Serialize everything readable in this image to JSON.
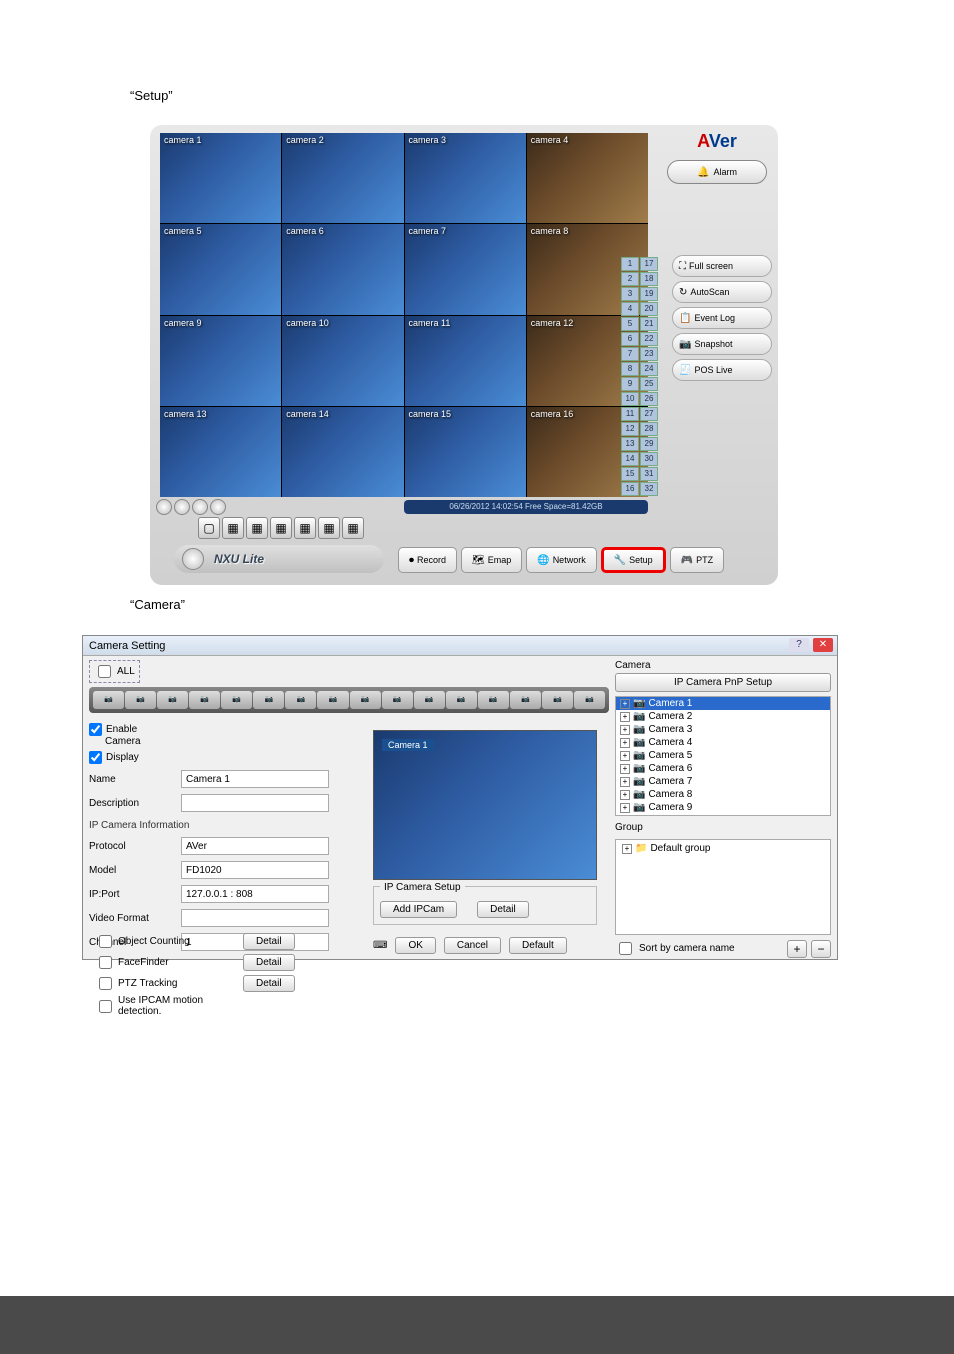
{
  "instructions": {
    "line1": "“Setup”",
    "line2": "“Camera”"
  },
  "app": {
    "logo": "AVer",
    "alarm": "Alarm",
    "brand": "NXU Lite",
    "status": "06/26/2012 14:02:54  Free Space=81.42GB",
    "side_buttons": [
      "Full screen",
      "AutoScan",
      "Event Log",
      "Snapshot",
      "POS Live"
    ],
    "bottom_buttons": [
      "Record",
      "Emap",
      "Network",
      "Setup",
      "PTZ"
    ],
    "cameras": [
      "camera 1",
      "camera 2",
      "camera 3",
      "camera 4",
      "camera 5",
      "camera 6",
      "camera 7",
      "camera 8",
      "camera 9",
      "camera 10",
      "camera 11",
      "camera 12",
      "camera 13",
      "camera 14",
      "camera 15",
      "camera 16"
    ],
    "channel_numbers": [
      "1",
      "17",
      "2",
      "18",
      "3",
      "19",
      "4",
      "20",
      "5",
      "21",
      "6",
      "22",
      "7",
      "23",
      "8",
      "24",
      "9",
      "25",
      "10",
      "26",
      "11",
      "27",
      "12",
      "28",
      "13",
      "29",
      "14",
      "30",
      "15",
      "31",
      "16",
      "32"
    ]
  },
  "dialog": {
    "title": "Camera Setting",
    "all": "ALL",
    "enable": "Enable",
    "camera_lbl": "Camera",
    "display": "Display",
    "name_lbl": "Name",
    "name_val": "Camera 1",
    "desc_lbl": "Description",
    "desc_val": "",
    "ip_info": "IP Camera Information",
    "protocol_lbl": "Protocol",
    "protocol_val": "AVer",
    "model_lbl": "Model",
    "model_val": "FD1020",
    "ipport_lbl": "IP:Port",
    "ipport_val": "127.0.0.1 : 808",
    "vfmt_lbl": "Video Format",
    "vfmt_val": "",
    "channel_lbl": "Channel",
    "channel_val": "1",
    "obj_counting": "Object Counting",
    "facefinder": "FaceFinder",
    "ptz_tracking": "PTZ Tracking",
    "use_ipcam": "Use IPCAM motion detection.",
    "detail": "Detail",
    "ip_setup": "IP Camera Setup",
    "add_ipcam": "Add IPCam",
    "ok": "OK",
    "cancel": "Cancel",
    "default": "Default",
    "preview_label": "Camera 1",
    "right_hdr": "Camera",
    "pnp": "IP Camera PnP Setup",
    "cam_list": [
      "Camera 1",
      "Camera 2",
      "Camera 3",
      "Camera 4",
      "Camera 5",
      "Camera 6",
      "Camera 7",
      "Camera 8",
      "Camera 9"
    ],
    "group_hdr": "Group",
    "default_group": "Default group",
    "sort": "Sort by camera name"
  }
}
